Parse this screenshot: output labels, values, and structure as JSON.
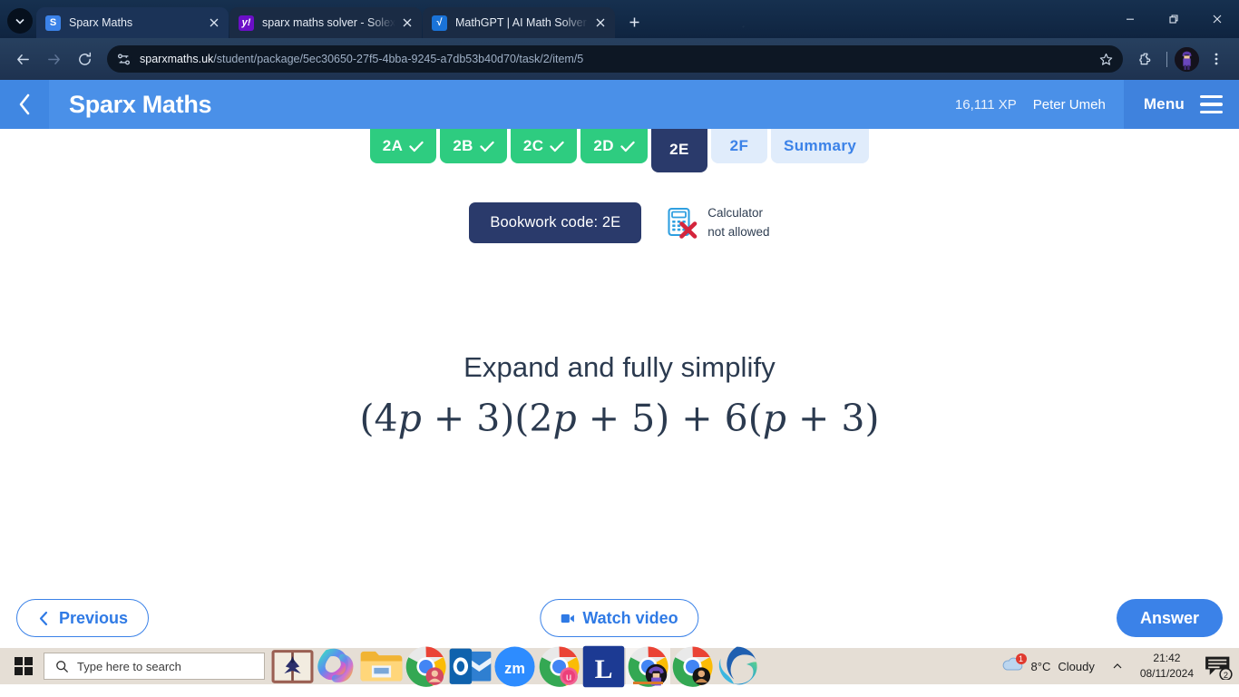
{
  "browser": {
    "tab_list_icon": "chevron-down-icon",
    "tabs": [
      {
        "title": "Sparx Maths",
        "favicon": "sparx-favicon",
        "favicon_glyph": "S",
        "active": true
      },
      {
        "title": "sparx maths solver - Solex Yahoo",
        "favicon": "yahoo-favicon",
        "favicon_glyph": "y!",
        "active": false
      },
      {
        "title": "MathGPT | AI Math Solver & Calculator",
        "favicon": "mathgpt-favicon",
        "favicon_glyph": "√",
        "active": false
      }
    ],
    "new_tab_label": "+",
    "window_controls": {
      "minimize": "minimize-icon",
      "restore": "restore-icon",
      "close": "close-icon"
    },
    "toolbar": {
      "back": "back-arrow-icon",
      "forward": "forward-arrow-icon",
      "reload": "reload-icon",
      "site_info": "site-settings-icon",
      "url_domain": "sparxmaths.uk",
      "url_path": "/student/package/5ec30650-27f5-4bba-9245-a7db53b40d70/task/2/item/5",
      "bookmark": "star-icon",
      "extensions": "puzzle-piece-icon",
      "profile": "profile-avatar",
      "menu": "three-dot-menu-icon"
    }
  },
  "sparx": {
    "header": {
      "back_icon": "chevron-left-icon",
      "title": "Sparx Maths",
      "xp": "16,111 XP",
      "user": "Peter Umeh",
      "menu_label": "Menu",
      "menu_icon": "hamburger-icon"
    },
    "task_tabs": [
      {
        "label": "2A",
        "state": "done"
      },
      {
        "label": "2B",
        "state": "done"
      },
      {
        "label": "2C",
        "state": "done"
      },
      {
        "label": "2D",
        "state": "done"
      },
      {
        "label": "2E",
        "state": "current"
      },
      {
        "label": "2F",
        "state": "todo"
      },
      {
        "label": "Summary",
        "state": "todo"
      }
    ],
    "bookwork": {
      "code_label": "Bookwork code: 2E",
      "calculator_icon": "calculator-not-allowed-icon",
      "calculator_line1": "Calculator",
      "calculator_line2": "not allowed"
    },
    "question": {
      "prompt": "Expand and fully simplify",
      "expression_plain": "(4p + 3)(2p + 5) + 6(p + 3)",
      "expr_parts": {
        "a": "(4",
        "v1": "p",
        "b": " + 3)(2",
        "v2": "p",
        "c": " + 5) + 6(",
        "v3": "p",
        "d": " + 3)"
      }
    },
    "actions": {
      "previous_label": "Previous",
      "previous_icon": "chevron-left-icon",
      "watch_video_label": "Watch video",
      "watch_video_icon": "video-camera-icon",
      "answer_label": "Answer"
    },
    "colors": {
      "header_blue": "#4a90e8",
      "accent_blue": "#3b82e8",
      "done_green": "#2ecc80",
      "navy": "#2a3a6b",
      "todo_blue_bg": "#e0ecfb"
    }
  },
  "taskbar": {
    "start_icon": "windows-start-icon",
    "search_icon": "search-icon",
    "search_placeholder": "Type here to search",
    "pinned": [
      {
        "name": "widgets-book-icon"
      },
      {
        "name": "copilot-icon"
      },
      {
        "name": "file-explorer-icon"
      },
      {
        "name": "chrome-icon"
      },
      {
        "name": "outlook-icon"
      },
      {
        "name": "zoom-icon"
      },
      {
        "name": "chrome-icon"
      },
      {
        "name": "l-app-icon"
      },
      {
        "name": "chrome-active-icon"
      },
      {
        "name": "chrome-icon"
      },
      {
        "name": "edge-icon"
      }
    ],
    "tray": {
      "weather_icon": "cloud-icon",
      "weather_badge": "1",
      "temperature": "8°C",
      "condition": "Cloudy",
      "overflow_icon": "chevron-up-icon",
      "time": "21:42",
      "date": "08/11/2024",
      "notification_icon": "notification-icon",
      "notification_count": "2"
    }
  }
}
